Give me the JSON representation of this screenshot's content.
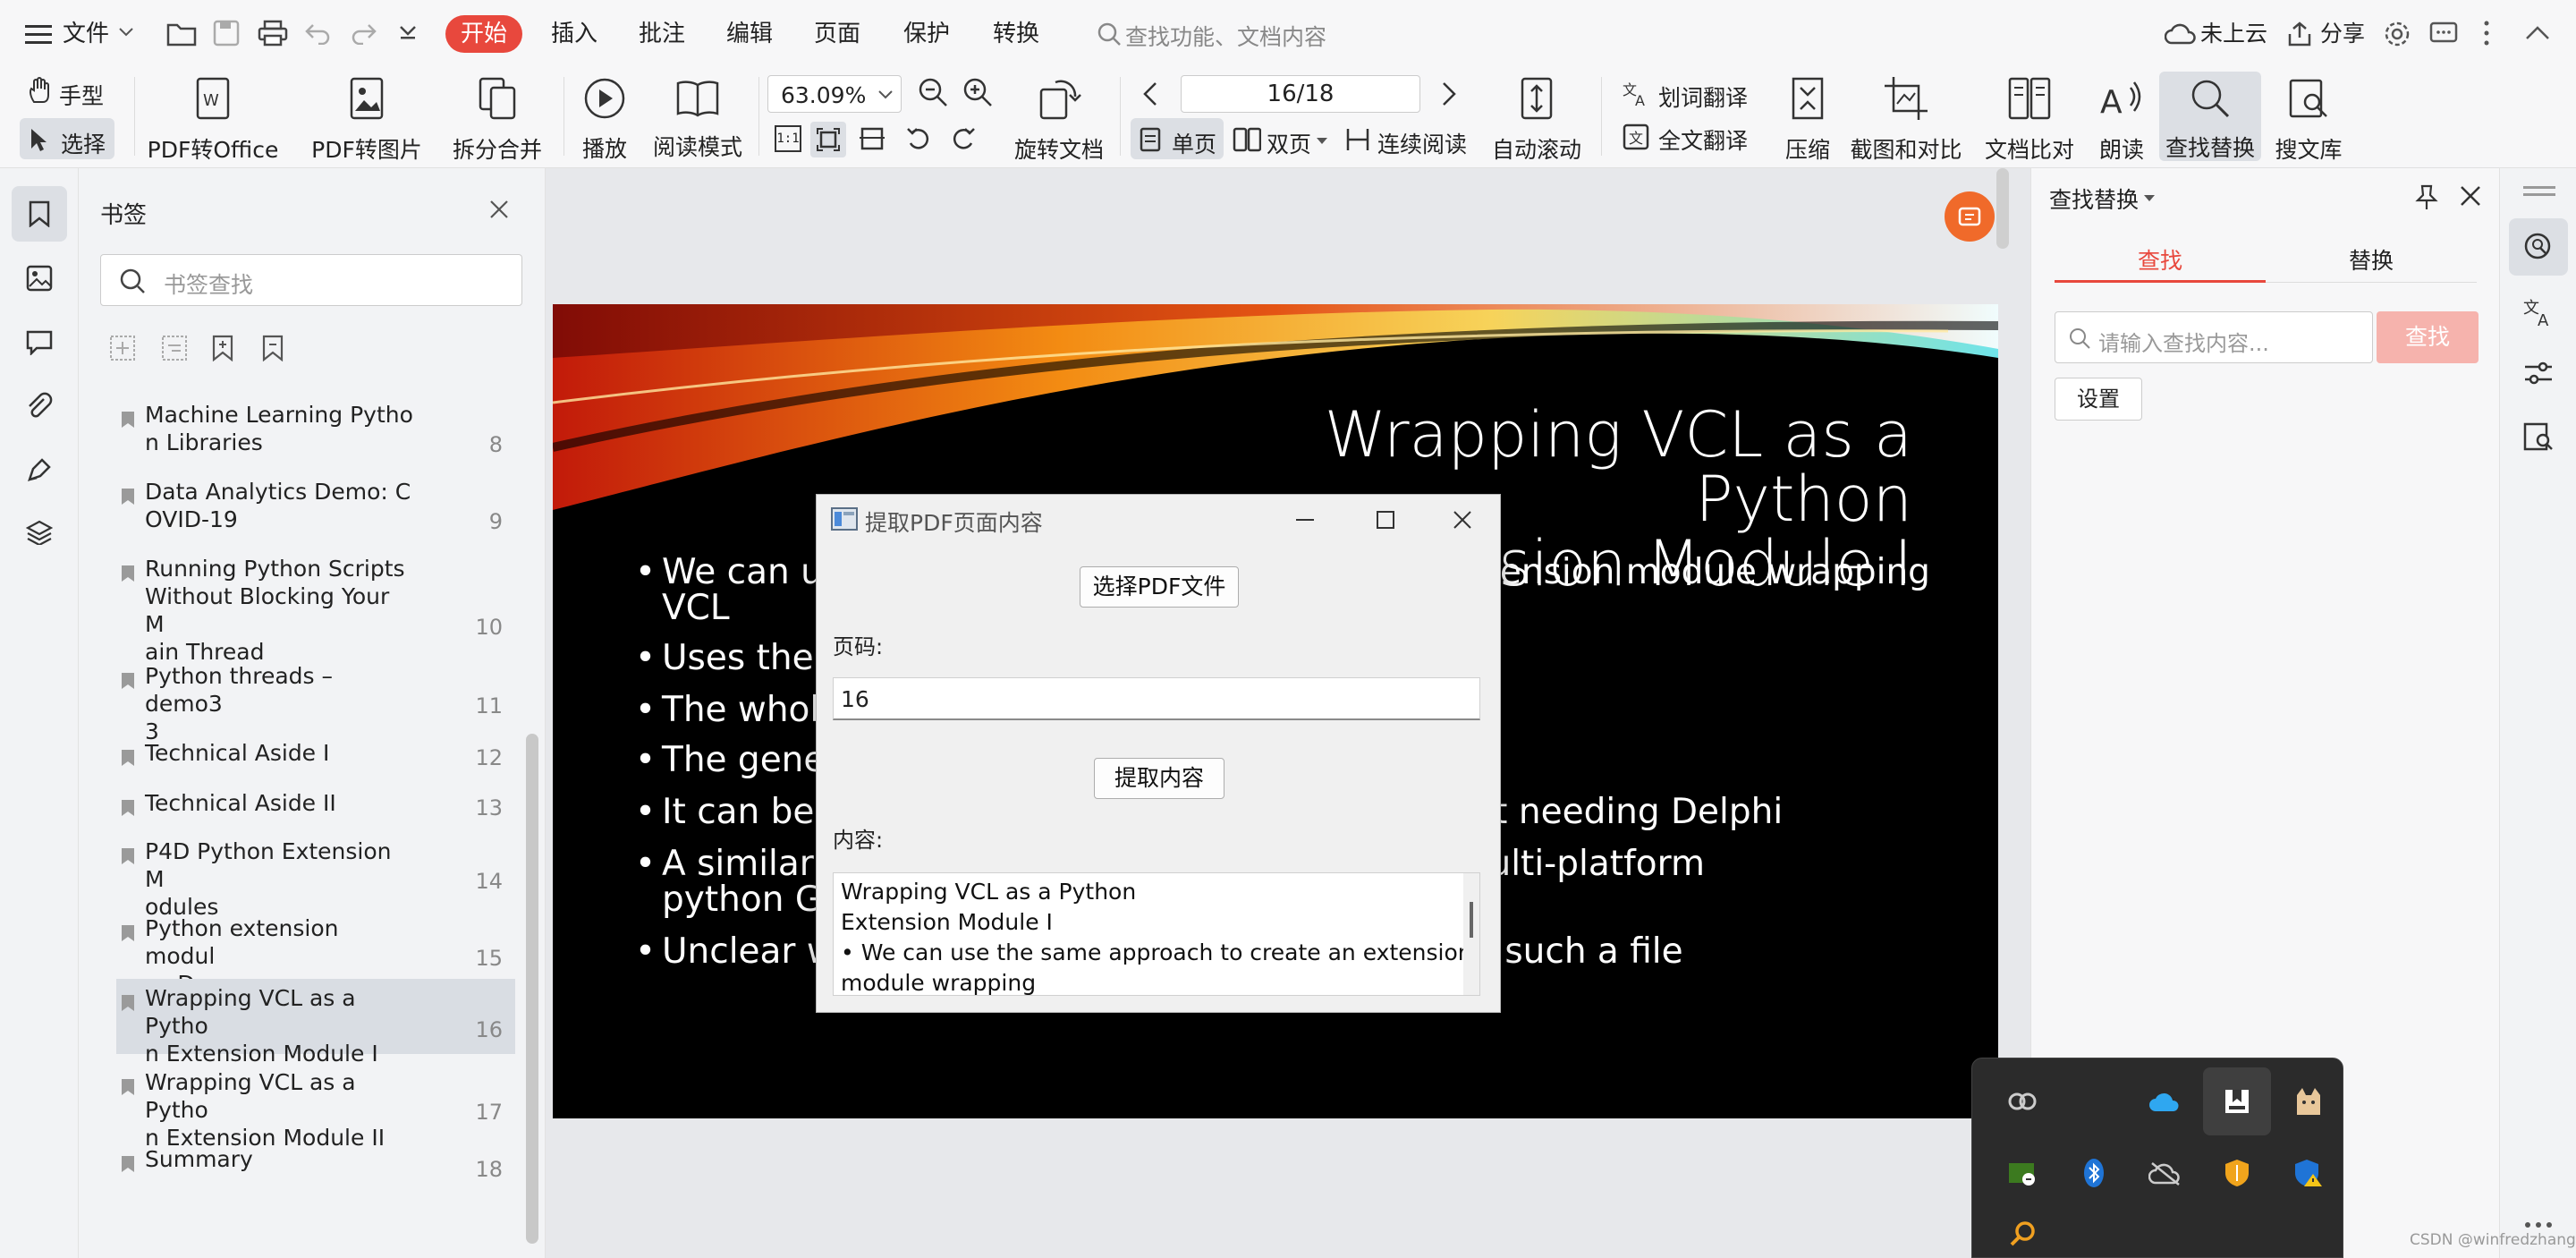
{
  "menubar": {
    "file": "文件",
    "start": "开始",
    "items": [
      "插入",
      "批注",
      "编辑",
      "页面",
      "保护",
      "转换"
    ],
    "search_placeholder": "查找功能、文档内容",
    "cloud": "未上云",
    "share": "分享"
  },
  "toolbar": {
    "hand": "手型",
    "select": "选择",
    "pdf_to_office": "PDF转Office",
    "pdf_to_image": "PDF转图片",
    "split_merge": "拆分合并",
    "play": "播放",
    "read_mode": "阅读模式",
    "zoom": "63.09%",
    "rotate_doc": "旋转文档",
    "page_indicator": "16/18",
    "single": "单页",
    "double": "双页",
    "continuous": "连续阅读",
    "autoscroll": "自动滚动",
    "word_translate": "划词翻译",
    "full_translate": "全文翻译",
    "compress": "压缩",
    "screenshot_compare": "截图和对比",
    "doc_compare": "文档比对",
    "read_aloud": "朗读",
    "find_replace": "查找替换",
    "search_library": "搜文库"
  },
  "bookmarks": {
    "title": "书签",
    "search_placeholder": "书签查找",
    "items": [
      {
        "label": "Machine Learning Pytho\nn Libraries",
        "page": "8"
      },
      {
        "label": "Data Analytics Demo:  C\nOVID-19",
        "page": "9"
      },
      {
        "label": "Running Python Scripts\nWithout Blocking Your M\nain Thread",
        "page": "10"
      },
      {
        "label": "Python threads – demo3\n3",
        "page": "11"
      },
      {
        "label": "Technical Aside I",
        "page": "12"
      },
      {
        "label": "Technical Aside II",
        "page": "13"
      },
      {
        "label": "P4D Python Extension M\nodules",
        "page": "14"
      },
      {
        "label": "Python extension modul\nes Demo",
        "page": "15"
      },
      {
        "label": "Wrapping VCL as a Pytho\nn Extension Module I",
        "page": "16"
      },
      {
        "label": "Wrapping VCL as a Pytho\nn Extension Module II",
        "page": "17"
      },
      {
        "label": "Summary",
        "page": "18"
      }
    ]
  },
  "slide": {
    "title_line1": "Wrapping VCL as a Python",
    "title_line2": "Extension Module I",
    "bullets": [
      "We can use the same approach to create an extension module wrapping",
      "VCL",
      "Uses the WrapDelphi and WrapDelphiVCL units",
      "The whole of VCL requires almost no code",
      "The generated pyd file is about 5 MB",
      "It can be used to create VCL-based GUIs without needing Delphi",
      "A similar approach could be used to create a multi-platform",
      "python GUI library based on FMX",
      "Unclear whether there are issues in distributing such a file"
    ]
  },
  "dialog": {
    "title": "提取PDF页面内容",
    "select_button": "选择PDF文件",
    "page_label": "页码:",
    "page_value": "16",
    "extract_button": "提取内容",
    "content_label": "内容:",
    "content_lines": [
      "Wrapping VCL as a Python",
      "Extension Module I",
      "• We can use the same approach to create an extension",
      "module wrapping"
    ]
  },
  "findpanel": {
    "title": "查找替换",
    "tab_find": "查找",
    "tab_replace": "替换",
    "input_placeholder": "请输入查找内容...",
    "find_button": "查找",
    "settings_button": "设置"
  },
  "watermark": "CSDN @winfredzhang",
  "colors": {
    "accent": "#e8483d",
    "find_button_disabled": "#f6b3ad"
  }
}
